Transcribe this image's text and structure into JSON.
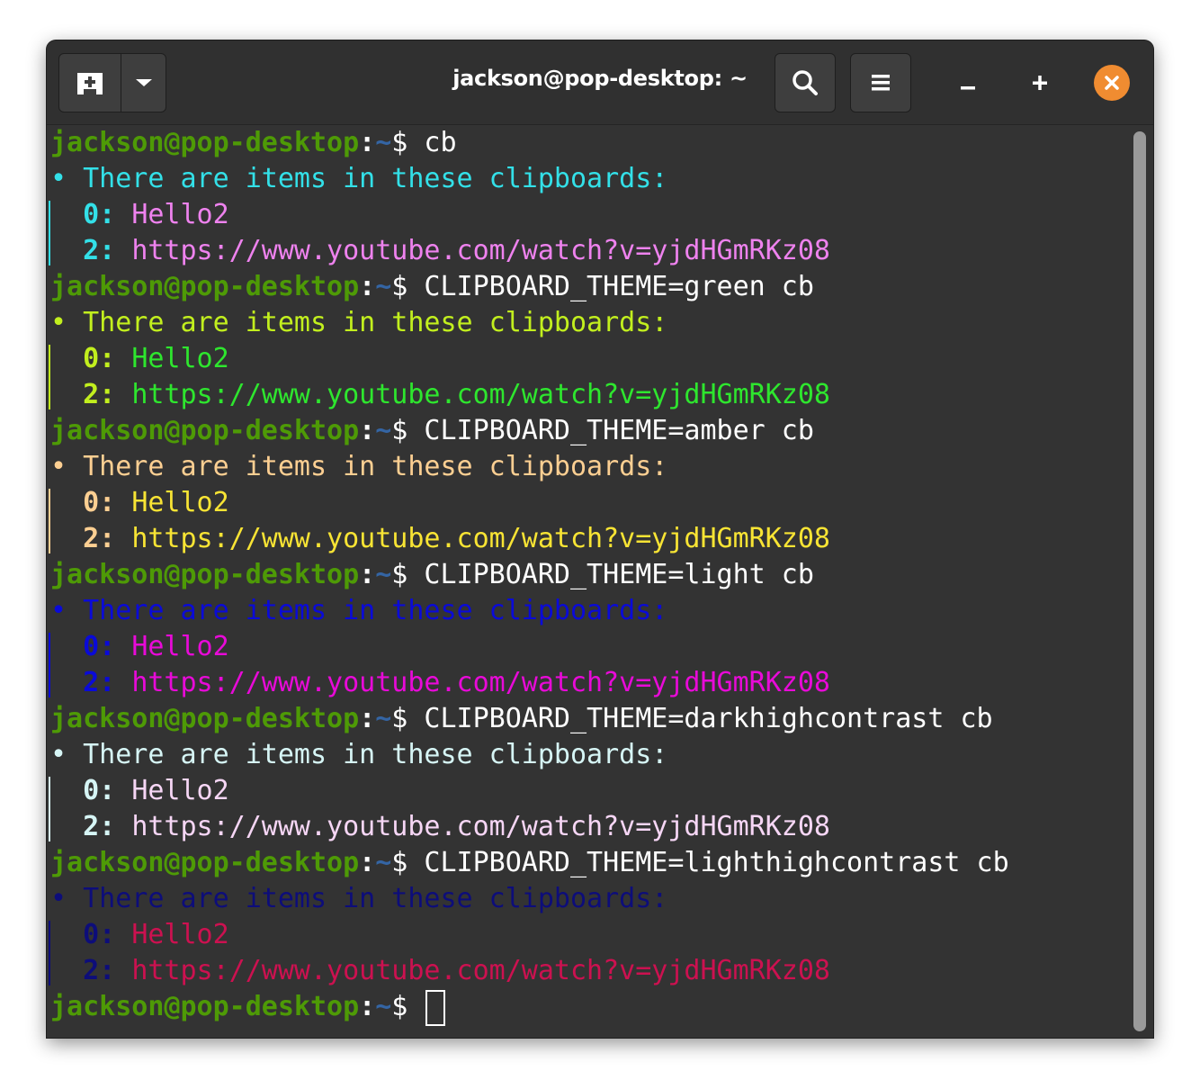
{
  "window": {
    "title": "jackson@pop-desktop: ~",
    "buttons": {
      "new_tab": "new-tab-icon",
      "dropdown": "chevron-down-icon",
      "search": "search-icon",
      "menu": "hamburger-menu-icon",
      "minimize": "minimize-icon",
      "maximize": "maximize-icon",
      "close": "close-icon"
    },
    "colors": {
      "close_button": "#f08c31",
      "background": "#333333"
    }
  },
  "prompt": {
    "user_host": "jackson@pop-desktop",
    "colon": ":",
    "path": "~",
    "dollar": "$ ",
    "user_color": "#4e9a06",
    "path_color": "#3465a4"
  },
  "blocks": [
    {
      "command": "cb",
      "bullet": "• ",
      "header": "There are items in these clipboards:",
      "entries": [
        {
          "index": "0:",
          "text": "Hello2"
        },
        {
          "index": "2:",
          "text": "https://www.youtube.com/watch?v=yjdHGmRKz08"
        }
      ],
      "colors": {
        "header": "#33e0e8",
        "index": "#33e0e8",
        "text": "#ee82ee",
        "bar": "#33e0e8"
      }
    },
    {
      "command": "CLIPBOARD_THEME=green cb",
      "bullet": "• ",
      "header": "There are items in these clipboards:",
      "entries": [
        {
          "index": "0:",
          "text": "Hello2"
        },
        {
          "index": "2:",
          "text": "https://www.youtube.com/watch?v=yjdHGmRKz08"
        }
      ],
      "colors": {
        "header": "#c2ef1e",
        "index": "#c2ef1e",
        "text": "#2ee62e",
        "bar": "#c2ef1e"
      }
    },
    {
      "command": "CLIPBOARD_THEME=amber cb",
      "bullet": "• ",
      "header": "There are items in these clipboards:",
      "entries": [
        {
          "index": "0:",
          "text": "Hello2"
        },
        {
          "index": "2:",
          "text": "https://www.youtube.com/watch?v=yjdHGmRKz08"
        }
      ],
      "colors": {
        "header": "#fccf92",
        "index": "#fccf92",
        "text": "#f8e434",
        "bar": "#fccf92"
      }
    },
    {
      "command": "CLIPBOARD_THEME=light cb",
      "bullet": "• ",
      "header": "There are items in these clipboards:",
      "entries": [
        {
          "index": "0:",
          "text": "Hello2"
        },
        {
          "index": "2:",
          "text": "https://www.youtube.com/watch?v=yjdHGmRKz08"
        }
      ],
      "colors": {
        "header": "#0a0ad8",
        "index": "#0a0ad8",
        "text": "#e80ad8",
        "bar": "#0a0ad8"
      }
    },
    {
      "command": "CLIPBOARD_THEME=darkhighcontrast cb",
      "bullet": "• ",
      "header": "There are items in these clipboards:",
      "entries": [
        {
          "index": "0:",
          "text": "Hello2"
        },
        {
          "index": "2:",
          "text": "https://www.youtube.com/watch?v=yjdHGmRKz08"
        }
      ],
      "colors": {
        "header": "#d6f5f5",
        "index": "#d6f5f5",
        "text": "#f6d6f5",
        "bar": "#d6f5f5"
      }
    },
    {
      "command": "CLIPBOARD_THEME=lighthighcontrast cb",
      "bullet": "• ",
      "header": "There are items in these clipboards:",
      "entries": [
        {
          "index": "0:",
          "text": "Hello2"
        },
        {
          "index": "2:",
          "text": "https://www.youtube.com/watch?v=yjdHGmRKz08"
        }
      ],
      "colors": {
        "header": "#0d0d7a",
        "index": "#0d0d7a",
        "text": "#cc1150",
        "bar": "#0d0d7a"
      }
    }
  ],
  "final_prompt_input": ""
}
